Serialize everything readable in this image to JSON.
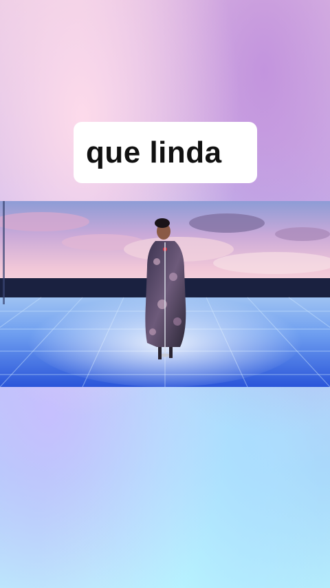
{
  "caption": {
    "text": "que linda"
  },
  "video": {
    "scene": "stage-performance",
    "colors": {
      "sky_top": "#9aa6d8",
      "sky_pink": "#e9b4d2",
      "floor_blue": "#2f6fe8",
      "floor_light": "#b8e4ff"
    }
  }
}
